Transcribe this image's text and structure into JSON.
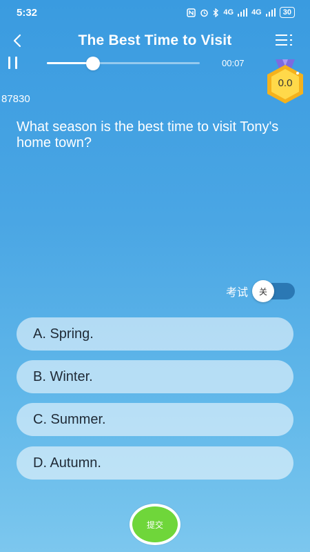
{
  "status_bar": {
    "time": "5:32",
    "network_1": "4G",
    "network_2": "4G",
    "battery": "30"
  },
  "header": {
    "title": "The Best Time to Visit",
    "back_icon": "chevron-left-icon",
    "menu_icon": "list-menu-icon"
  },
  "player": {
    "time": "00:07",
    "progress": 0.3,
    "pause_icon": "pause-icon"
  },
  "score": {
    "value": "0.0",
    "badge_color": "#f5b21c"
  },
  "question": {
    "id": "87830",
    "text": "What season is the best time to visit Tony's home town?"
  },
  "exam_mode": {
    "label": "考试",
    "toggle_text": "关",
    "enabled": false
  },
  "options": [
    {
      "label": "A. Spring."
    },
    {
      "label": "B. Winter."
    },
    {
      "label": "C. Summer."
    },
    {
      "label": "D. Autumn."
    }
  ],
  "submit": {
    "label": "提交",
    "color": "#6fd63a"
  }
}
